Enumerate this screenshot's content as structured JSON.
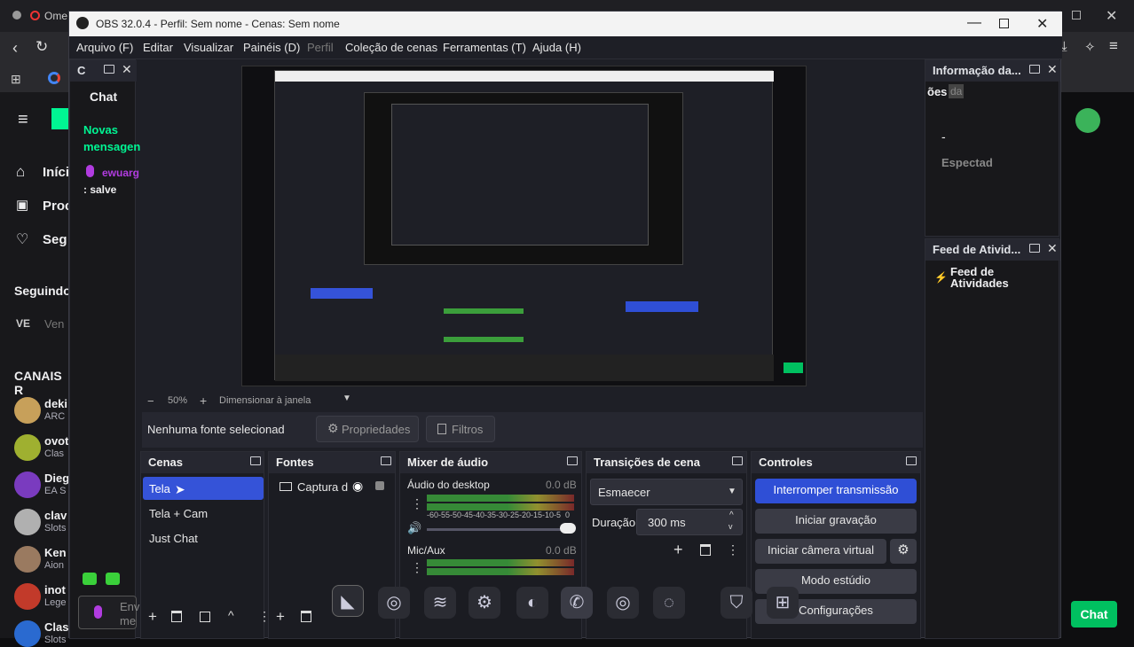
{
  "browser": {
    "tab_title": "Ome",
    "sidebar_items": [
      "Iníci",
      "Proc",
      "Seg"
    ],
    "seguindo_label": "Seguindo",
    "canais_label": "CANAIS R",
    "channels": [
      {
        "name": "deki",
        "sub": "ARC",
        "color": "#c7a05a"
      },
      {
        "name": "ovot",
        "sub": "Clas",
        "color": "#9fb030"
      },
      {
        "name": "Dieg",
        "sub": "EA S",
        "color": "#7a3bbf"
      },
      {
        "name": "clav",
        "sub": "Slots",
        "color": "#b0b0b0"
      },
      {
        "name": "Ken",
        "sub": "Aion",
        "color": "#9a7a60"
      },
      {
        "name": "inot",
        "sub": "Lege",
        "color": "#c23a2a"
      },
      {
        "name": "Clas",
        "sub": "Slots",
        "color": "#2a6ad0"
      }
    ],
    "ve_label": "Ven",
    "chat_button": "Chat"
  },
  "obs": {
    "window_title": "OBS 32.0.4 - Perfil: Sem nome - Cenas: Sem nome",
    "menu": [
      "Arquivo (F)",
      "Editar",
      "Visualizar",
      "Painéis (D)",
      "Perfil",
      "Coleção de cenas",
      "Ferramentas (T)",
      "Ajuda (H)"
    ],
    "chat_dock": {
      "title": "C",
      "heading": "Chat",
      "new_messages_1": "Novas",
      "new_messages_2": "mensagen",
      "user": "ewuarg",
      "message": ": salve",
      "input_placeholder_1": "Env",
      "input_placeholder_2": "me"
    },
    "preview_bar": {
      "minus": "−",
      "zoom": "50%",
      "plus": "+",
      "mode": "Dimensionar à janela"
    },
    "source_bar": {
      "no_source": "Nenhuma fonte selecionad",
      "properties": "Propriedades",
      "filters": "Filtros"
    },
    "scenes": {
      "title": "Cenas",
      "items": [
        "Tela",
        "Tela + Cam",
        "Just Chat"
      ]
    },
    "sources": {
      "title": "Fontes",
      "items": [
        "Captura d"
      ]
    },
    "mixer": {
      "title": "Mixer de áudio",
      "channels": [
        {
          "name": "Áudio do desktop",
          "db": "0.0 dB",
          "level": 0.92
        },
        {
          "name": "Mic/Aux",
          "db": "0.0 dB",
          "level": 0.92
        }
      ],
      "ticks": [
        "-60",
        "-55",
        "-50",
        "-45",
        "-40",
        "-35",
        "-30",
        "-25",
        "-20",
        "-15",
        "-10",
        "-5",
        "0"
      ]
    },
    "transitions": {
      "title": "Transições de cena",
      "selected": "Esmaecer",
      "duration_label": "Duração",
      "duration_value": "300 ms"
    },
    "controls": {
      "title": "Controles",
      "buttons": [
        "Interromper transmissão",
        "Iniciar gravação",
        "Iniciar câmera virtual",
        "Modo estúdio",
        "Configurações"
      ]
    },
    "info_dock": {
      "title": "Informação da...",
      "line1": "ões",
      "line1_tag": "da",
      "dash": "-",
      "spectators": "Espectad"
    },
    "activity_dock": {
      "title": "Feed de Ativid...",
      "heading_1": "Feed de",
      "heading_2": "Atividades"
    }
  },
  "taskbar": {
    "icons": [
      "vs-icon",
      "discord-icon",
      "spotify-icon",
      "steam-icon",
      "app-icon",
      "whatsapp-icon",
      "discord-icon-2",
      "obs-icon",
      "brave-icon",
      "grid-icon"
    ]
  },
  "colors": {
    "accent_blue": "#2f4fd6",
    "selected_scene": "#3553d8",
    "twitch_green": "#00f593",
    "obs_bg": "#1e1f26"
  }
}
